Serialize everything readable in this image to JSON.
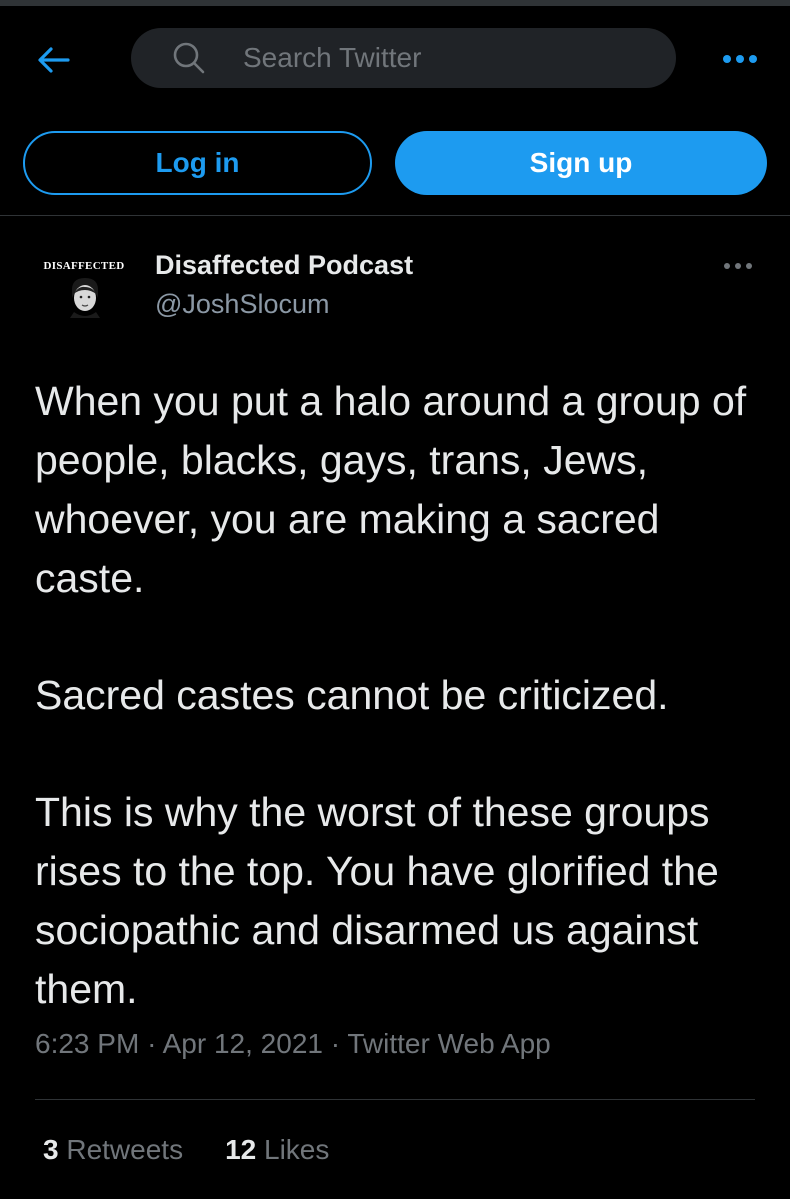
{
  "header": {
    "back_icon": "arrow-left-icon",
    "search": {
      "placeholder": "Search Twitter",
      "icon": "search-icon"
    },
    "more_icon": "more-horizontal-icon"
  },
  "auth": {
    "login_label": "Log in",
    "signup_label": "Sign up"
  },
  "tweet": {
    "avatar_logo_text": "DISAFFECTED",
    "author_name": "Disaffected Podcast",
    "author_handle": "@JoshSlocum",
    "paragraphs": [
      "When you put a halo around a group of people, blacks, gays, trans, Jews, whoever, you are making a sacred caste.",
      "Sacred castes cannot be criticized.",
      "This is why the worst of these groups rises to the top. You have glorified the sociopathic and disarmed us against them."
    ],
    "time": "6:23 PM",
    "date": "Apr 12, 2021",
    "source": "Twitter Web App",
    "retweets_count": "3",
    "retweets_label": "Retweets",
    "likes_count": "12",
    "likes_label": "Likes"
  },
  "colors": {
    "background": "#000000",
    "accent": "#1d9bf0",
    "primary_text": "#e7e9ea",
    "secondary_text": "#71767b",
    "search_bg": "#202327",
    "divider": "#2f3336"
  }
}
